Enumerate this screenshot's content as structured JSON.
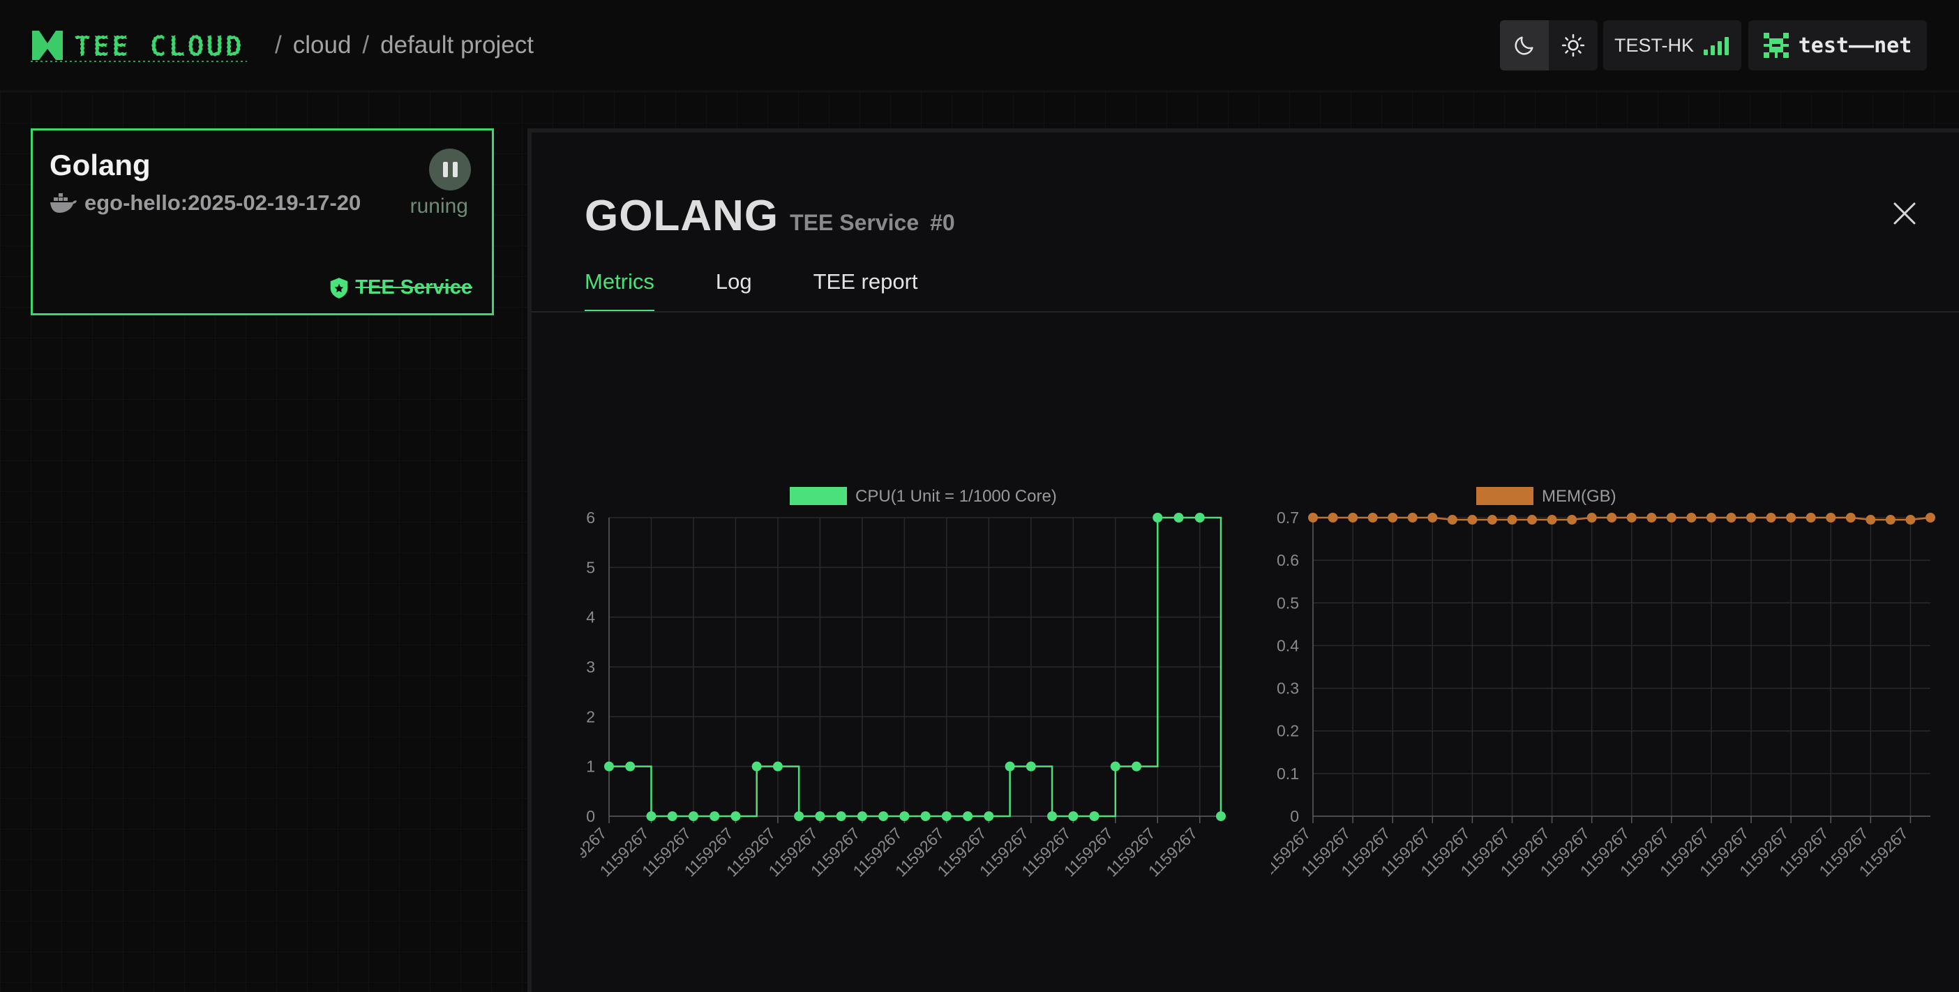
{
  "header": {
    "logo_text": "TEE CLOUD",
    "breadcrumb": [
      "cloud",
      "default project"
    ],
    "region_label": "TEST-HK",
    "network_label": "test——net",
    "theme_icons": [
      "moon-icon",
      "sun-icon"
    ]
  },
  "card": {
    "title": "Golang",
    "image": "ego-hello:2025-02-19-17-20",
    "status": "runing",
    "tag": "TEE Service",
    "border_color": "#3ed66e"
  },
  "panel": {
    "title": "GOLANG",
    "subtitle": "TEE Service",
    "index": "#0",
    "tabs": [
      "Metrics",
      "Log",
      "TEE report"
    ],
    "active_tab": "Metrics"
  },
  "colors": {
    "accent": "#4be07b",
    "cpu": "#4be07b",
    "mem": "#c2732f"
  },
  "chart_data": [
    {
      "type": "line",
      "step": true,
      "title": "",
      "legend": "CPU(1 Unit = 1/1000 Core)",
      "legend_placement": "top-center",
      "x_tick_label": "1159267",
      "xlabel": "",
      "ylabel": "",
      "ylim": [
        0,
        6
      ],
      "yticks": [
        0,
        1,
        2,
        3,
        4,
        5,
        6
      ],
      "grid": true,
      "series": [
        {
          "name": "CPU(1 Unit = 1/1000 Core)",
          "values": [
            1,
            1,
            0,
            0,
            0,
            0,
            0,
            1,
            1,
            0,
            0,
            0,
            0,
            0,
            0,
            0,
            0,
            0,
            0,
            1,
            1,
            0,
            0,
            0,
            1,
            1,
            6,
            6,
            6,
            0
          ]
        }
      ]
    },
    {
      "type": "line",
      "title": "",
      "legend": "MEM(GB)",
      "legend_placement": "top-center",
      "x_tick_label": "1159267",
      "xlabel": "",
      "ylabel": "",
      "ylim": [
        0,
        0.7
      ],
      "yticks": [
        0,
        0.1,
        0.2,
        0.3,
        0.4,
        0.5,
        0.6,
        0.7
      ],
      "grid": true,
      "series": [
        {
          "name": "MEM(GB)",
          "values": [
            0.7,
            0.7,
            0.7,
            0.7,
            0.7,
            0.7,
            0.7,
            0.695,
            0.695,
            0.695,
            0.695,
            0.695,
            0.695,
            0.695,
            0.7,
            0.7,
            0.7,
            0.7,
            0.7,
            0.7,
            0.7,
            0.7,
            0.7,
            0.7,
            0.7,
            0.7,
            0.7,
            0.7,
            0.695,
            0.695,
            0.695,
            0.7
          ]
        }
      ]
    }
  ]
}
